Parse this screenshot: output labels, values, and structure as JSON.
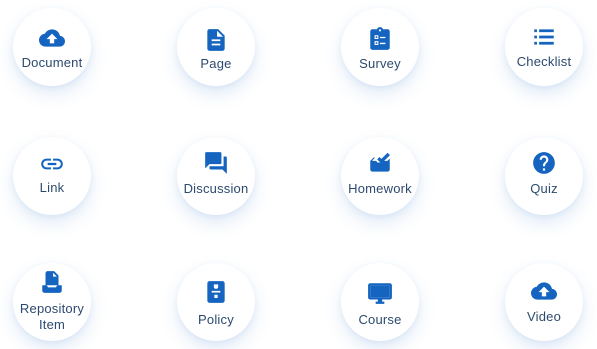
{
  "accent_color": "#1565c0",
  "label_color": "#2c4a6e",
  "items": [
    {
      "label": "Document",
      "icon": "cloud-upload-icon"
    },
    {
      "label": "Page",
      "icon": "page-icon"
    },
    {
      "label": "Survey",
      "icon": "clipboard-checklist-icon"
    },
    {
      "label": "Checklist",
      "icon": "list-icon"
    },
    {
      "label": "Link",
      "icon": "link-icon"
    },
    {
      "label": "Discussion",
      "icon": "chat-bubbles-icon"
    },
    {
      "label": "Homework",
      "icon": "inbox-check-icon"
    },
    {
      "label": "Quiz",
      "icon": "question-circle-icon"
    },
    {
      "label_line1": "Repository",
      "label_line2": "Item",
      "icon": "repository-icon"
    },
    {
      "label": "Policy",
      "icon": "policy-book-icon"
    },
    {
      "label": "Course",
      "icon": "monitor-icon"
    },
    {
      "label": "Video",
      "icon": "cloud-upload-icon"
    }
  ]
}
